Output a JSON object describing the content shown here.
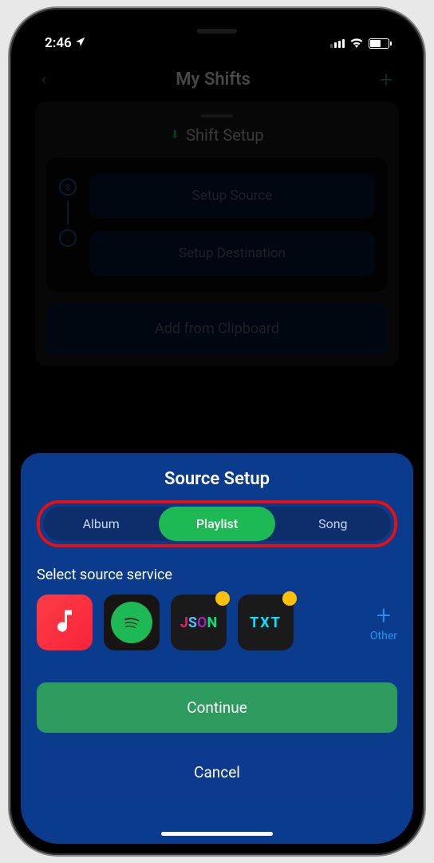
{
  "status": {
    "time": "2:46"
  },
  "nav": {
    "title": "My Shifts"
  },
  "panel": {
    "title": "Shift Setup",
    "source_btn": "Setup Source",
    "dest_btn": "Setup Destination",
    "clipboard": "Add from Clipboard"
  },
  "sheet": {
    "title": "Source Setup",
    "segments": [
      "Album",
      "Playlist",
      "Song"
    ],
    "selected_segment": 1,
    "service_label": "Select source service",
    "services": [
      {
        "name": "apple-music"
      },
      {
        "name": "spotify"
      },
      {
        "name": "json",
        "badge": true
      },
      {
        "name": "txt",
        "badge": true
      }
    ],
    "other_label": "Other",
    "continue": "Continue",
    "cancel": "Cancel"
  }
}
